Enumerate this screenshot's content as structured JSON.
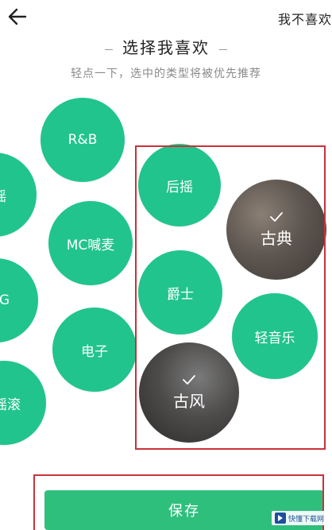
{
  "header": {
    "back_icon": "arrow-left-icon",
    "skip_label": "我不喜欢"
  },
  "title": "选择我喜欢",
  "subtitle": "轻点一下，选中的类型将被优先推荐",
  "genres": [
    {
      "id": "rnb",
      "label": "R&B",
      "selected": false
    },
    {
      "id": "yao-left",
      "label": "摇",
      "selected": false
    },
    {
      "id": "mc",
      "label": "MC喊麦",
      "selected": false
    },
    {
      "id": "g-left",
      "label": "G",
      "selected": false
    },
    {
      "id": "electronic",
      "label": "电子",
      "selected": false
    },
    {
      "id": "rock-left",
      "label": "摇滚",
      "selected": false
    },
    {
      "id": "post-rock",
      "label": "后摇",
      "selected": false
    },
    {
      "id": "classical",
      "label": "古典",
      "selected": true
    },
    {
      "id": "jazz",
      "label": "爵士",
      "selected": false
    },
    {
      "id": "light-music",
      "label": "轻音乐",
      "selected": false
    },
    {
      "id": "chinese-style",
      "label": "古风",
      "selected": true
    }
  ],
  "save_label": "保存",
  "watermark": {
    "text": "快懂下载网"
  },
  "colors": {
    "accent": "#21c48d",
    "save": "#2fbf7d",
    "highlight": "#c8323a",
    "text_primary": "#222222",
    "text_secondary": "#8a8a8a"
  }
}
